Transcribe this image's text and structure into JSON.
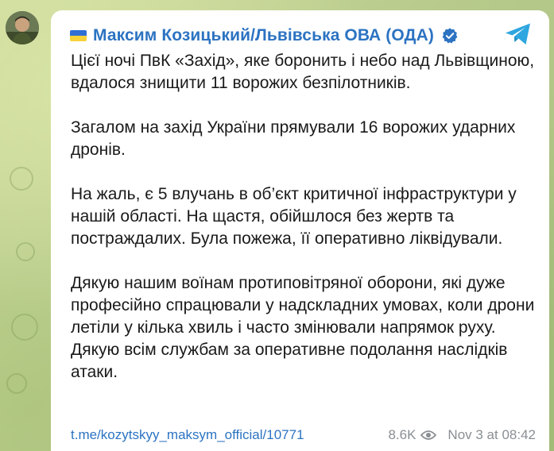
{
  "channel": {
    "flag_icon": "ukraine-flag-icon",
    "name": "Максим Козицький/Львівська ОВА (ОДА)",
    "verified_icon": "verified-badge-icon"
  },
  "message": {
    "paragraphs": [
      "Цієї ночі ПвК «Захід», яке боронить і небо над Львівщиною, вдалося знищити 11 ворожих безпілотників.",
      "Загалом на захід України прямували 16 ворожих ударних дронів.",
      "На жаль, є 5 влучань в об’єкт критичної інфраструктури у нашій області. На щастя, обійшлося без жертв та постраждалих. Була пожежа, її оперативно ліквідували.",
      "Дякую нашим воїнам протиповітряної оборони, які дуже професійно спрацювали у надскладних умовах, коли дрони летіли у кілька хвиль і часто змінювали напрямок руху. Дякую всім службам за оперативне подолання наслідків атаки."
    ]
  },
  "footer": {
    "link": "t.me/kozytskyy_maksym_official/10771",
    "views": "8.6K",
    "timestamp": "Nov 3 at 08:42"
  },
  "colors": {
    "accent": "#2c73c2",
    "meta_text": "#8a8f94",
    "telegram_blue": "#2ea6e0"
  }
}
